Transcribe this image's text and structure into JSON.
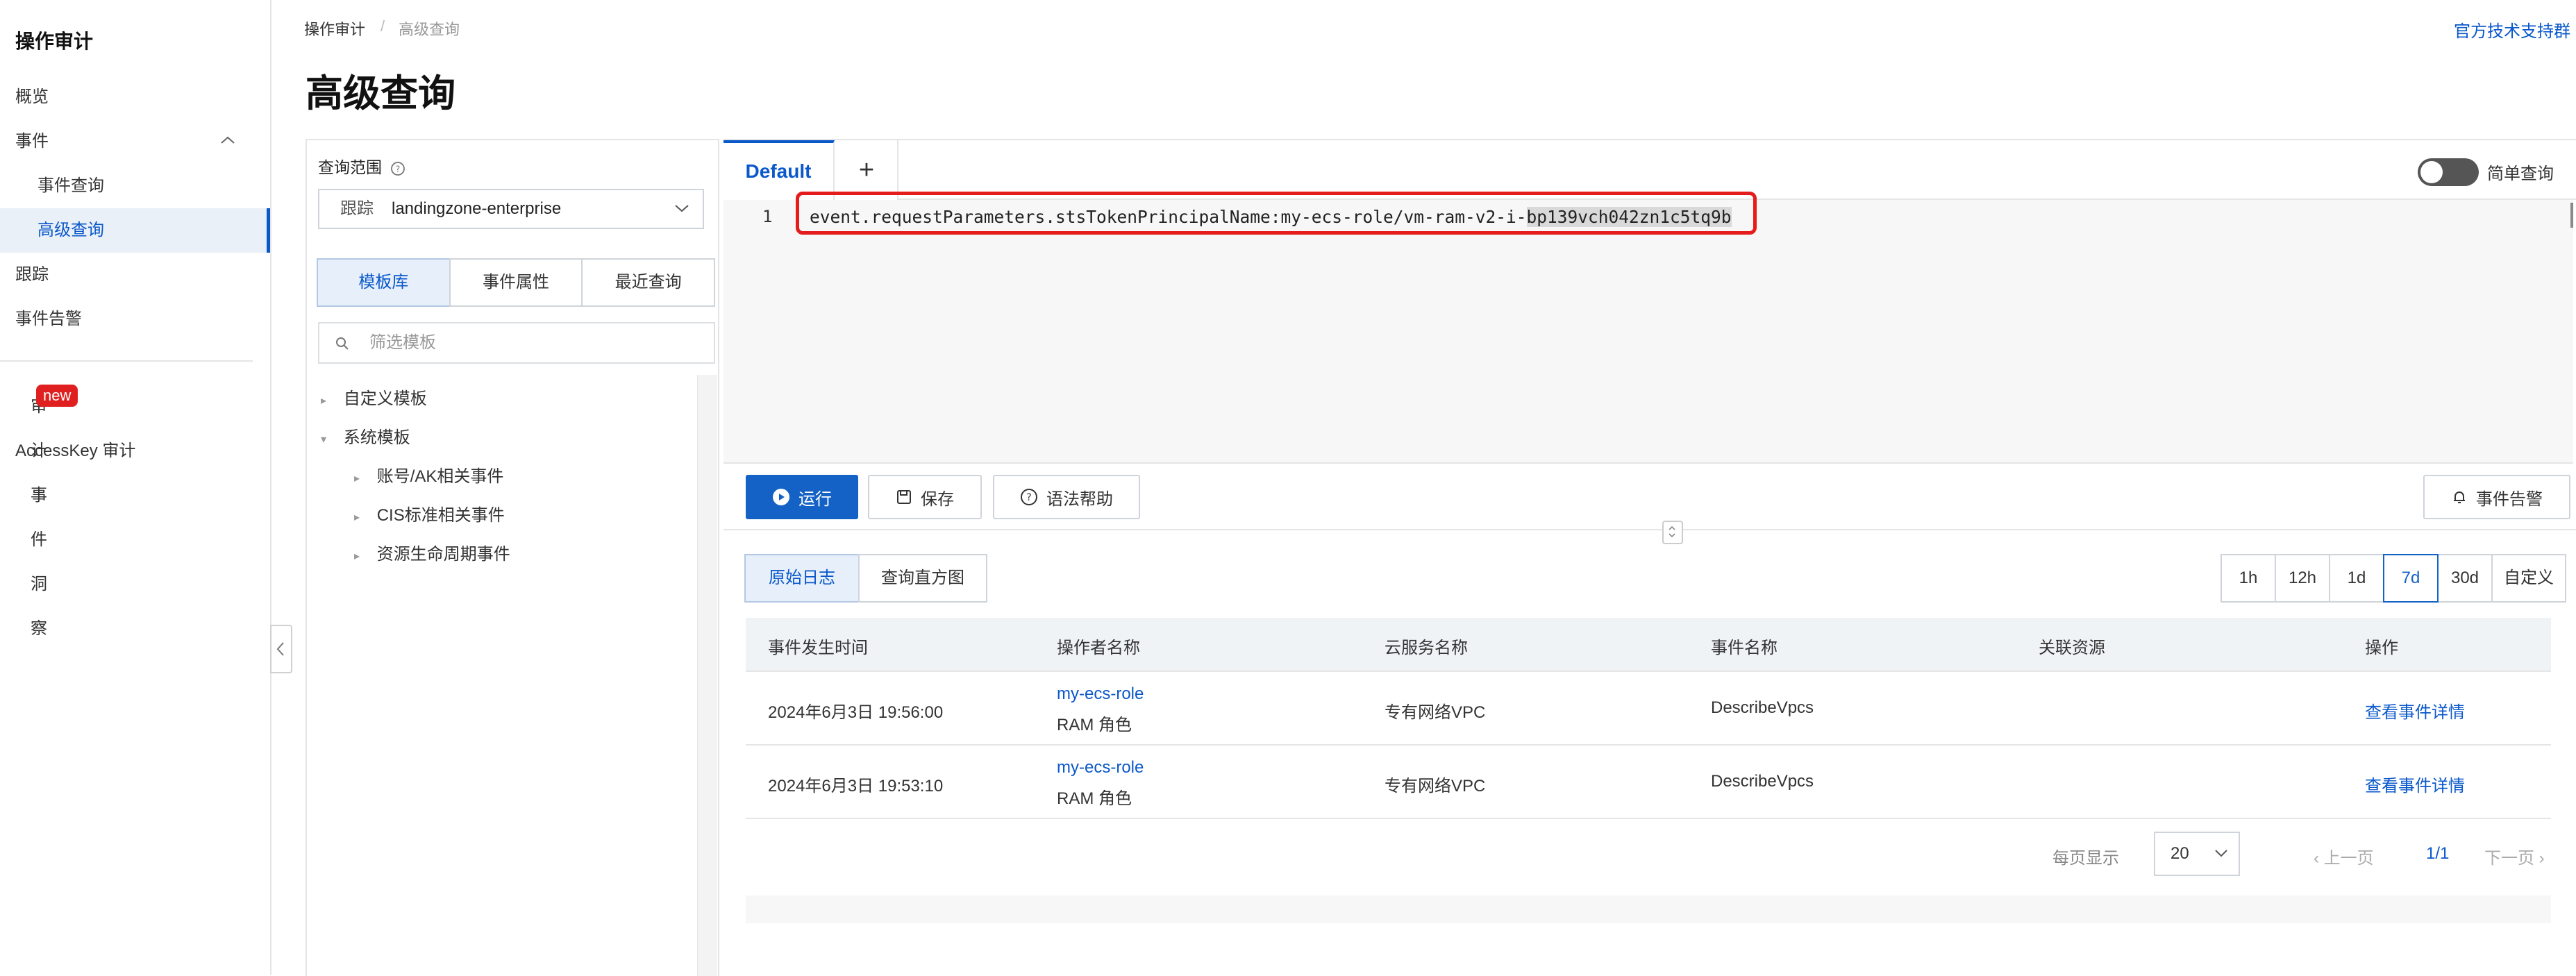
{
  "sidebar": {
    "title": "操作审计",
    "items": [
      {
        "label": "概览"
      },
      {
        "label": "事件"
      },
      {
        "label": "事件查询"
      },
      {
        "label": "高级查询"
      },
      {
        "label": "跟踪"
      },
      {
        "label": "事件告警"
      }
    ],
    "insight_label": "审计事件洞察",
    "insight_badge": "new",
    "accesskey_label": "AccessKey 审计"
  },
  "header": {
    "breadcrumb": [
      "操作审计",
      "/",
      "高级查询"
    ],
    "title": "高级查询",
    "support_link": "官方技术支持群"
  },
  "left_panel": {
    "scope_label": "查询范围",
    "scope_prefix": "跟踪",
    "scope_value": "landingzone-enterprise",
    "tabs": [
      "模板库",
      "事件属性",
      "最近查询"
    ],
    "active_tab": "模板库",
    "filter_placeholder": "筛选模板",
    "tree": [
      {
        "label": "自定义模板",
        "expanded": false
      },
      {
        "label": "系统模板",
        "expanded": true,
        "children": [
          "账号/AK相关事件",
          "CIS标准相关事件",
          "资源生命周期事件"
        ]
      }
    ]
  },
  "editor": {
    "tab_label": "Default",
    "add_tab": "+",
    "simple_query_label": "简单查询",
    "simple_query_on": false,
    "line_number": "1",
    "query_text": "event.requestParameters.stsTokenPrincipalName:my-ecs-role/vm-ram-v2-i-",
    "query_selected": "bp139vch042zn1c5tq9b"
  },
  "actions": {
    "run": "运行",
    "save": "保存",
    "syntax_help": "语法帮助",
    "event_alert": "事件告警"
  },
  "results": {
    "view_tabs": [
      "原始日志",
      "查询直方图"
    ],
    "active_view": "原始日志",
    "time_ranges": [
      "1h",
      "12h",
      "1d",
      "7d",
      "30d",
      "自定义"
    ],
    "active_time_range": "7d",
    "columns": [
      "事件发生时间",
      "操作者名称",
      "云服务名称",
      "事件名称",
      "关联资源",
      "操作"
    ],
    "rows": [
      {
        "time": "2024年6月3日 19:56:00",
        "actor": "my-ecs-role",
        "actor_type": "RAM 角色",
        "service": "专有网络VPC",
        "event": "DescribeVpcs",
        "resource": "",
        "action": "查看事件详情"
      },
      {
        "time": "2024年6月3日 19:53:10",
        "actor": "my-ecs-role",
        "actor_type": "RAM 角色",
        "service": "专有网络VPC",
        "event": "DescribeVpcs",
        "resource": "",
        "action": "查看事件详情"
      }
    ],
    "pager": {
      "per_page_label": "每页显示",
      "per_page": "20",
      "prev": "上一页",
      "page_info": "1/1",
      "next": "下一页"
    }
  },
  "colors": {
    "accent": "#0a58ca",
    "primary_button": "#1562c6",
    "highlight": "#e41c1c",
    "badge": "#e02020"
  }
}
